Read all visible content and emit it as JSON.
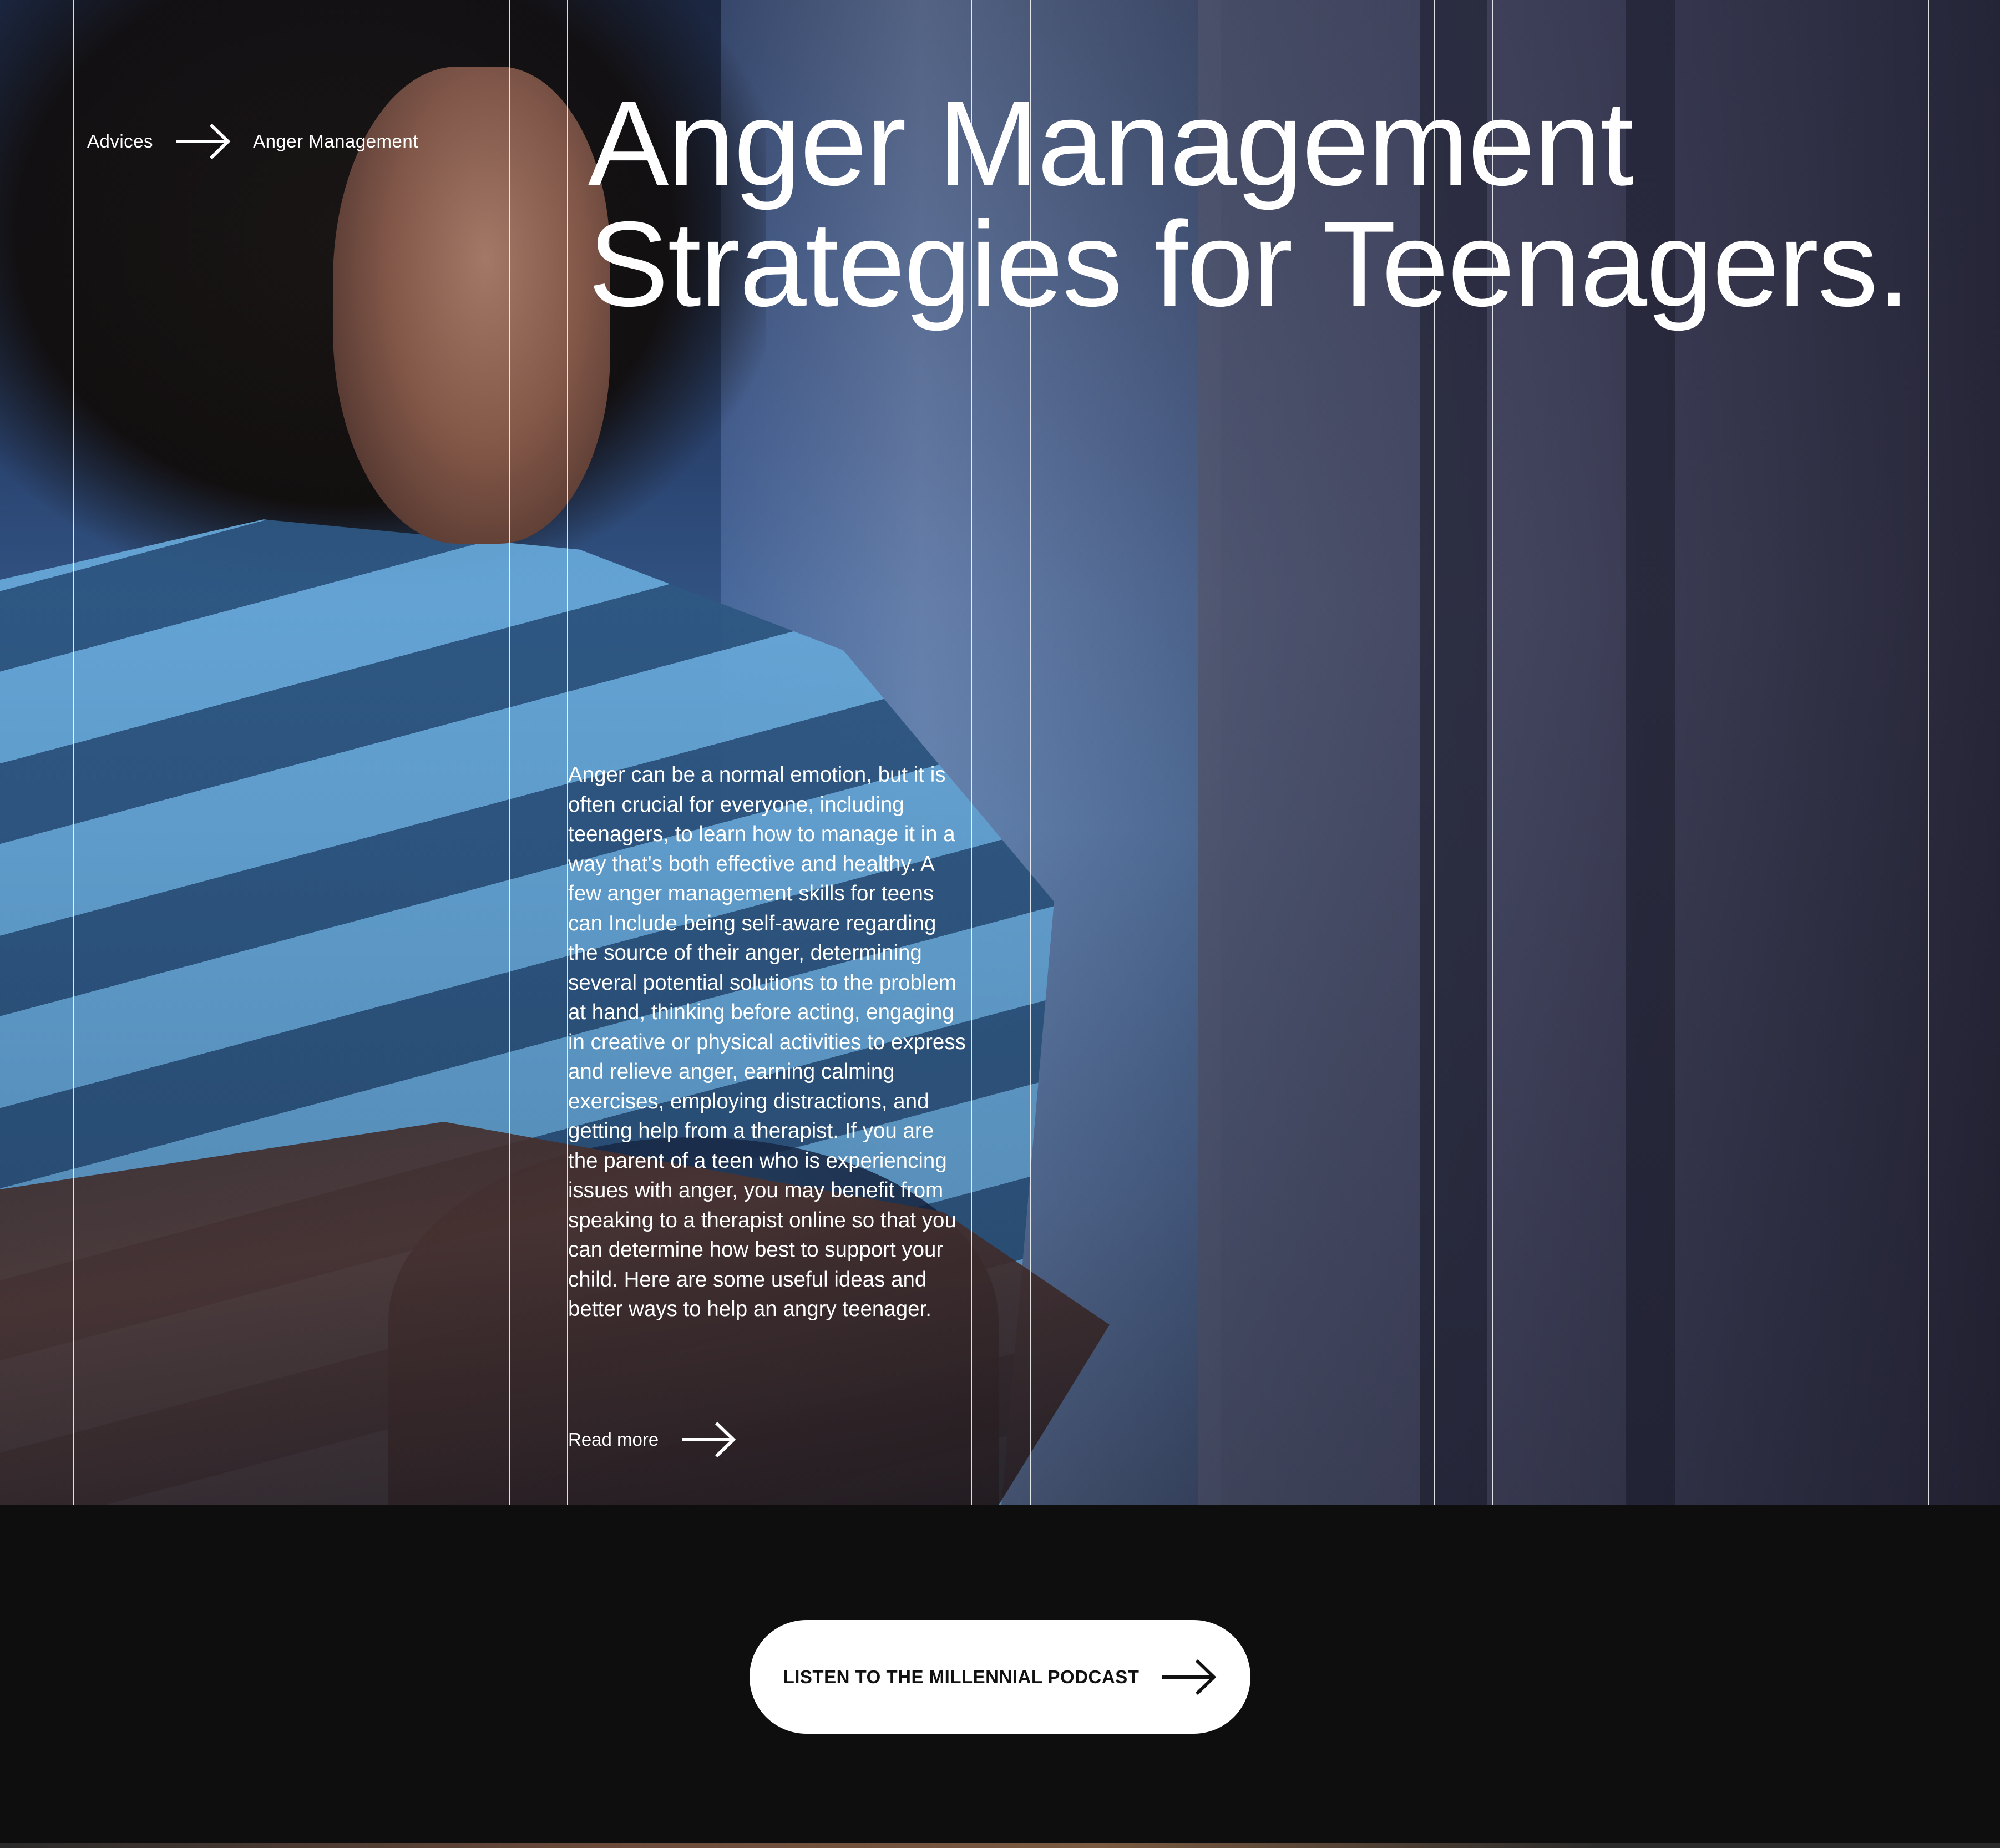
{
  "breadcrumb": {
    "parent": "Advices",
    "current": "Anger Management"
  },
  "hero": {
    "title_line1": "Anger Management",
    "title_line2": "Strategies for Teenagers.",
    "body": "Anger can be a normal emotion, but it is often crucial for everyone, including teenagers, to learn how to manage it in a way that's both effective and healthy. A few anger management skills for teens can Include being self-aware regarding the source of their anger, determining several potential solutions to the problem at hand, thinking before acting, engaging in creative or physical activities to express and relieve anger, earning calming exercises, employing distractions, and getting help from a therapist. If you are the parent of a teen who is experiencing issues with anger, you may benefit from speaking to a therapist online so that you can determine how best to support your child. Here are some useful ideas and better ways to help an angry teenager.",
    "read_more": "Read more"
  },
  "cta": {
    "podcast_label": "LISTEN TO THE MILLENNIAL PODCAST"
  },
  "icons": {
    "breadcrumb_separator": "arrow-right-icon",
    "read_more": "arrow-right-icon",
    "podcast": "arrow-right-icon"
  },
  "colors": {
    "page_background": "#0e0e0e",
    "text": "#ffffff",
    "button_background": "#ffffff",
    "button_text": "#111111"
  }
}
